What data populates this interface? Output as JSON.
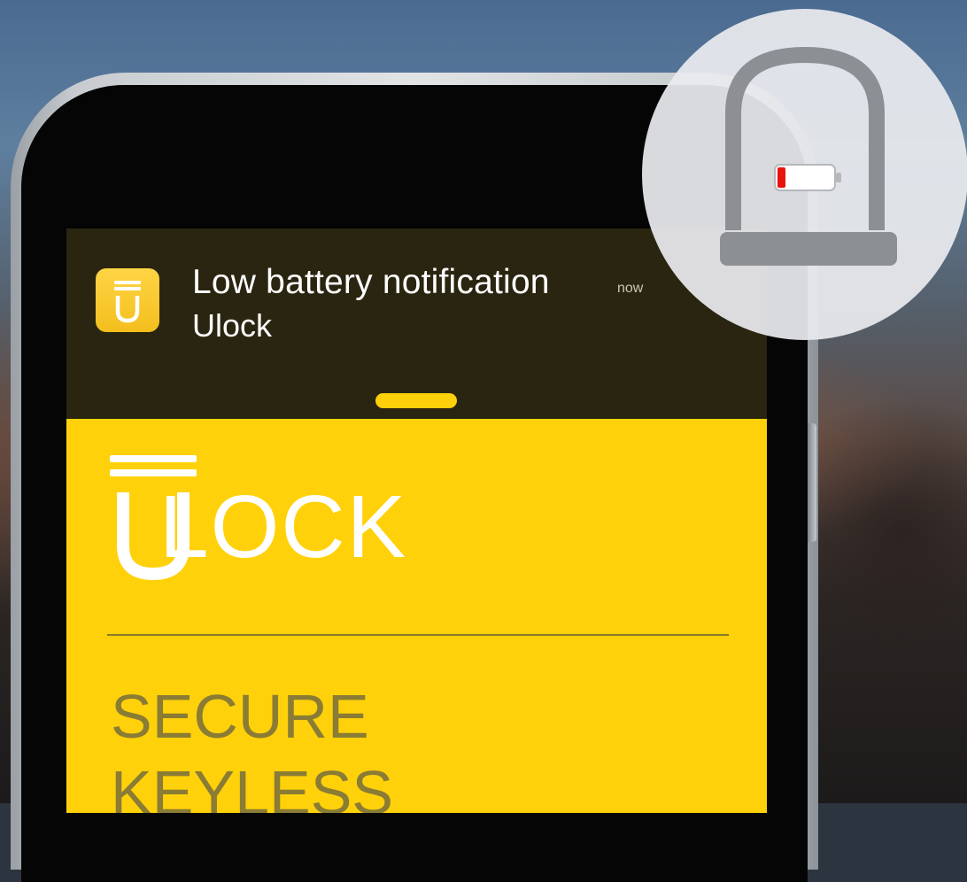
{
  "notification": {
    "title": "Low battery notification",
    "time": "now",
    "app_name": "Ulock",
    "app_icon": "ulock-app-icon"
  },
  "app": {
    "wordmark": "LOCK",
    "logo_icon": "ulock-logo-icon",
    "tagline": [
      "SECURE",
      "KEYLESS"
    ]
  },
  "badge": {
    "icon": "padlock-low-battery-icon",
    "battery_level_fraction": 0.15
  },
  "colors": {
    "brand_yellow": "#ffd10a",
    "notification_bg": "#2a2510",
    "tagline_text": "#8a7c34",
    "battery_low": "#e8140c",
    "lock_gray": "#8c8f93"
  }
}
